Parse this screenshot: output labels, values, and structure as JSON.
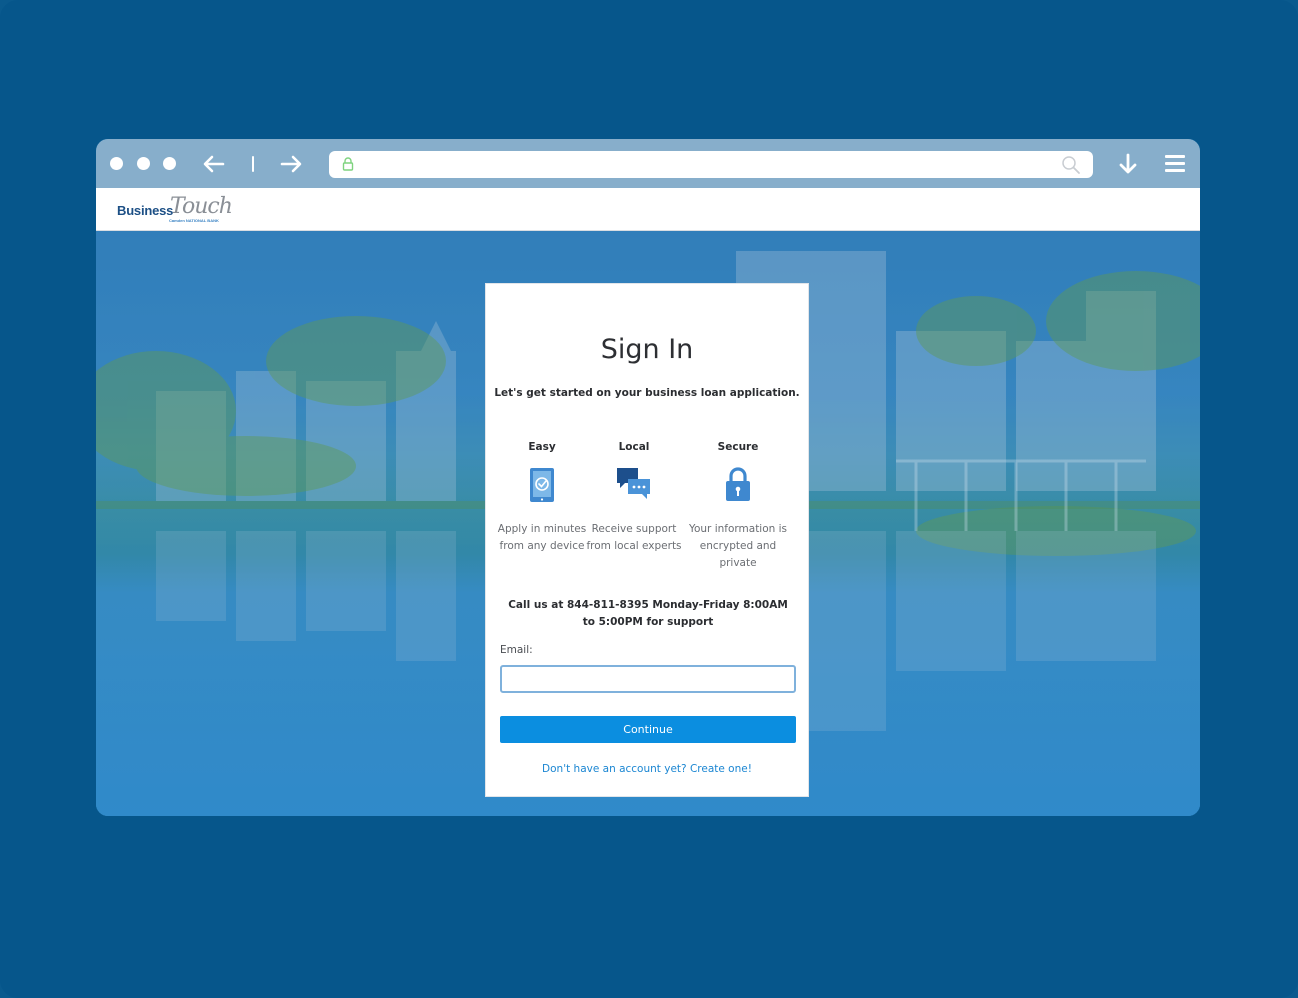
{
  "browser": {
    "address": {
      "value": "",
      "lock_icon": "lock-icon",
      "search_icon": "search-icon"
    },
    "icons": {
      "back": "arrow-left-icon",
      "forward": "arrow-right-icon",
      "download": "download-arrow-icon",
      "menu": "hamburger-menu-icon"
    },
    "colors": {
      "frame_background": "#06568b",
      "chrome_bar": "#87aecb",
      "page_overlay": "#1c78be"
    }
  },
  "site": {
    "logo": {
      "business": "Business",
      "touch": "Touch",
      "tagline": "Camden NATIONAL BANK"
    }
  },
  "signin": {
    "title": "Sign In",
    "intro": "Let's get started on your business loan application.",
    "features": [
      {
        "title": "Easy",
        "icon": "tablet-check-icon",
        "description": "Apply in minutes from any device"
      },
      {
        "title": "Local",
        "icon": "chat-bubbles-icon",
        "description": "Receive support from local experts"
      },
      {
        "title": "Secure",
        "icon": "padlock-icon",
        "description": "Your information is encrypted and private"
      }
    ],
    "call": "Call us at 844-811-8395 Monday-Friday 8:00AM to 5:00PM for support",
    "email_label": "Email:",
    "email_value": "",
    "continue_label": "Continue",
    "create_account_link": "Don't have an account yet? Create one!",
    "accent_color": "#0b8ee0"
  }
}
